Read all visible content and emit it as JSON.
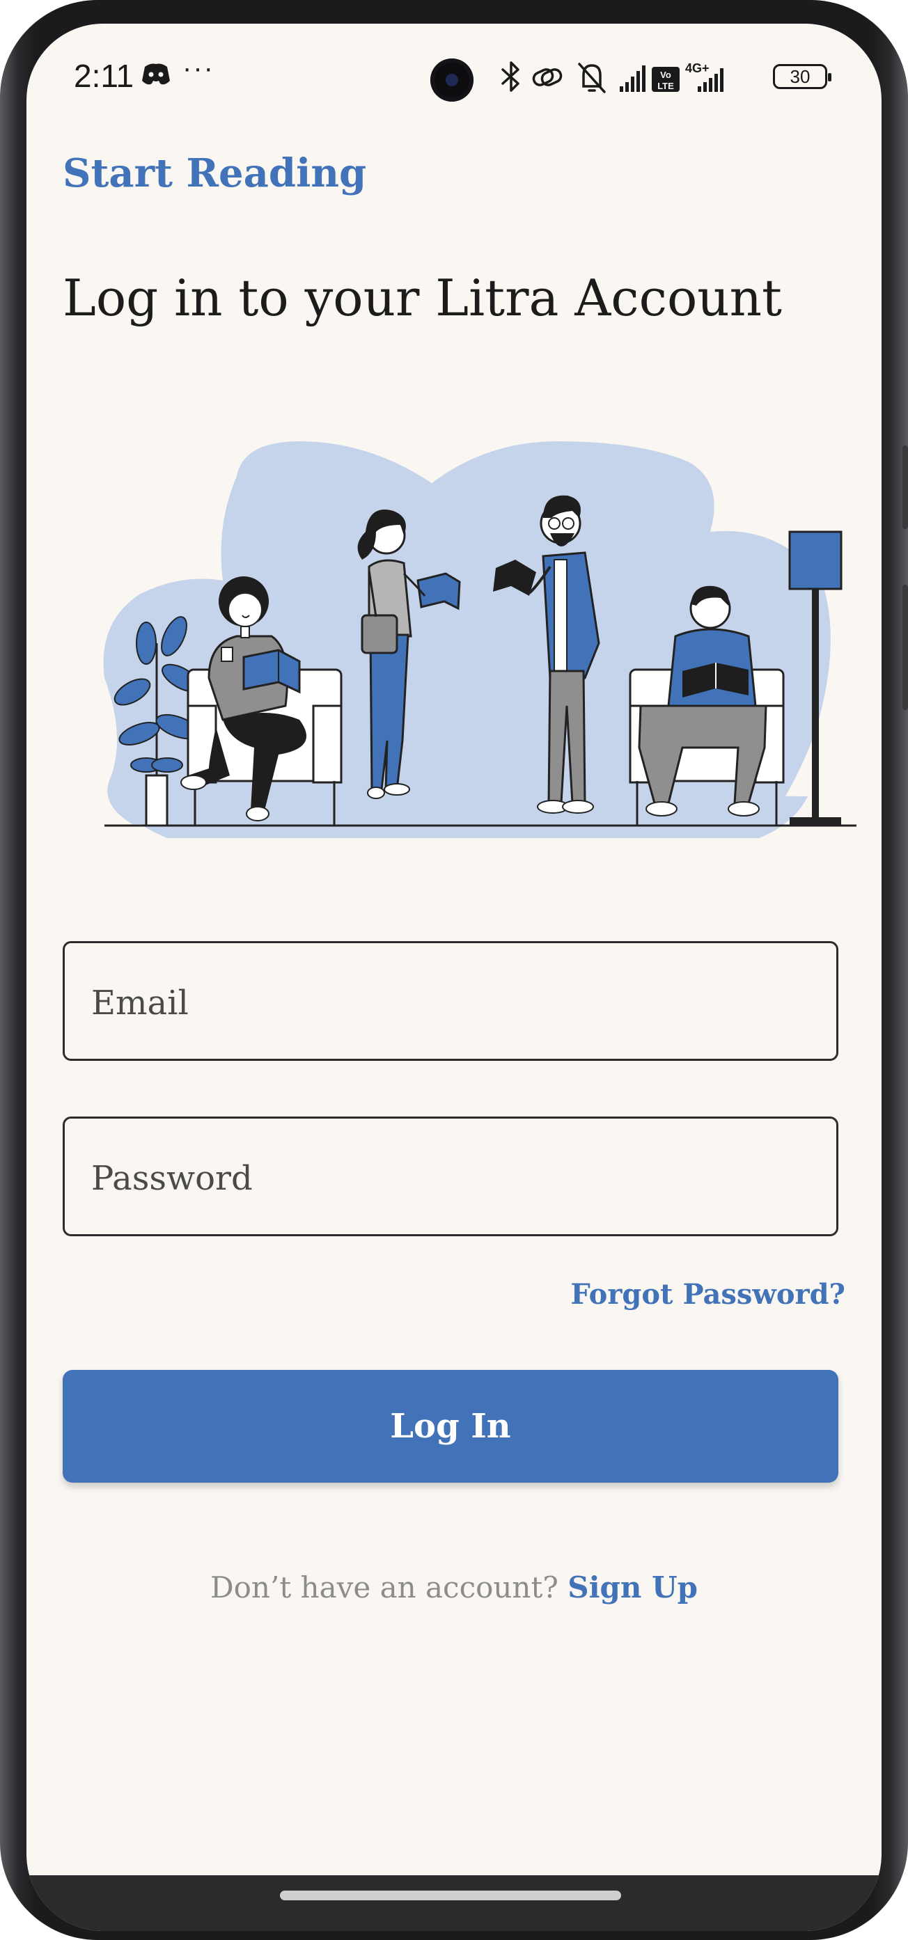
{
  "status_bar": {
    "time": "2:11",
    "overflow": "···",
    "battery": "30",
    "icons": [
      "discord-icon",
      "bluetooth-icon",
      "link-icon",
      "bell-off-icon",
      "signal-icon",
      "volte-icon",
      "4g-signal-icon",
      "battery-icon"
    ]
  },
  "app": {
    "brand": "Start Reading",
    "title": "Log in to your Litra Account"
  },
  "form": {
    "email_placeholder": "Email",
    "password_placeholder": "Password",
    "forgot_label": "Forgot Password?",
    "login_label": "Log In"
  },
  "footer": {
    "prompt": "Don’t have an account?",
    "signup_label": "Sign Up"
  },
  "colors": {
    "accent": "#4273b9",
    "background": "#faf7f2",
    "illustration_blob": "#c5d4ea"
  }
}
